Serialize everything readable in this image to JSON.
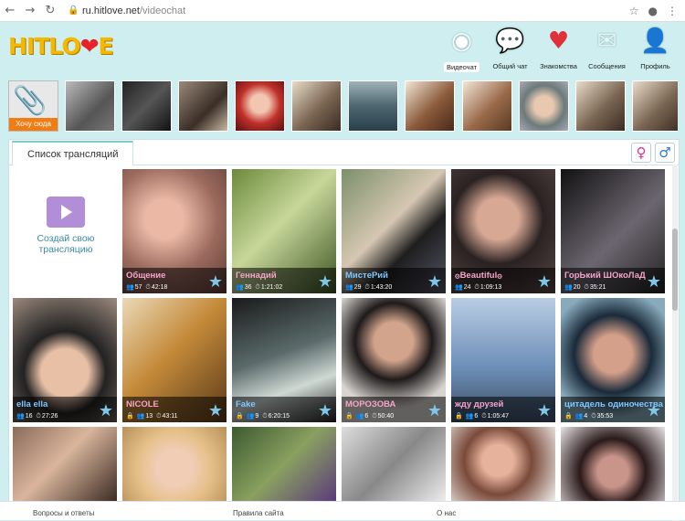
{
  "browser": {
    "host": "ru.hitlove.net",
    "path": "/videochat"
  },
  "logo": {
    "text": "HITLOVE"
  },
  "nav": [
    {
      "label": "Видеочат",
      "icon": "webcam-icon"
    },
    {
      "label": "Общий чат",
      "icon": "chat-bubbles-icon"
    },
    {
      "label": "Знакомства",
      "icon": "hearts-icon"
    },
    {
      "label": "Сообщения",
      "icon": "envelope-icon"
    },
    {
      "label": "Профиль",
      "icon": "user-icon"
    }
  ],
  "strip": {
    "want_label": "Хочу сюда",
    "thumb_count": 11
  },
  "tabs": {
    "list_label": "Список трансляций"
  },
  "create": {
    "label": "Создай свою трансляцию"
  },
  "cards": [
    {
      "name": "Общение",
      "viewers": "57",
      "time": "42:18",
      "color": "#f7a3c9"
    },
    {
      "name": "Геннадий",
      "viewers": "36",
      "time": "1:21:02",
      "color": "#f7a3c9"
    },
    {
      "name": "МистеРий",
      "viewers": "29",
      "time": "1:43:20",
      "color": "#7ec7ff"
    },
    {
      "name": "۞Beautiful۞",
      "viewers": "24",
      "time": "1:09:13",
      "color": "#f7a3c9"
    },
    {
      "name": "ГорЬкий ШОкоЛаД",
      "viewers": "20",
      "time": "35:21",
      "color": "#f7a3c9"
    },
    {
      "name": "ella ella",
      "viewers": "16",
      "time": "27:26",
      "color": "#7ec7ff"
    },
    {
      "name": "NICOLE",
      "viewers": "13",
      "time": "43:11",
      "color": "#f7a3c9"
    },
    {
      "name": "Fake",
      "viewers": "9",
      "time": "6:20:15",
      "color": "#7ec7ff"
    },
    {
      "name": "МОРОЗОВА",
      "viewers": "6",
      "time": "50:40",
      "color": "#f7a3c9"
    },
    {
      "name": "жду друзей",
      "viewers": "6",
      "time": "1:05:47",
      "color": "#f7a3c9"
    },
    {
      "name": "цитадель одиночества",
      "viewers": "4",
      "time": "35:53",
      "color": "#7ec7ff"
    }
  ],
  "bottom": [
    "Вопросы и ответы",
    "Правила сайта",
    "О нас"
  ]
}
